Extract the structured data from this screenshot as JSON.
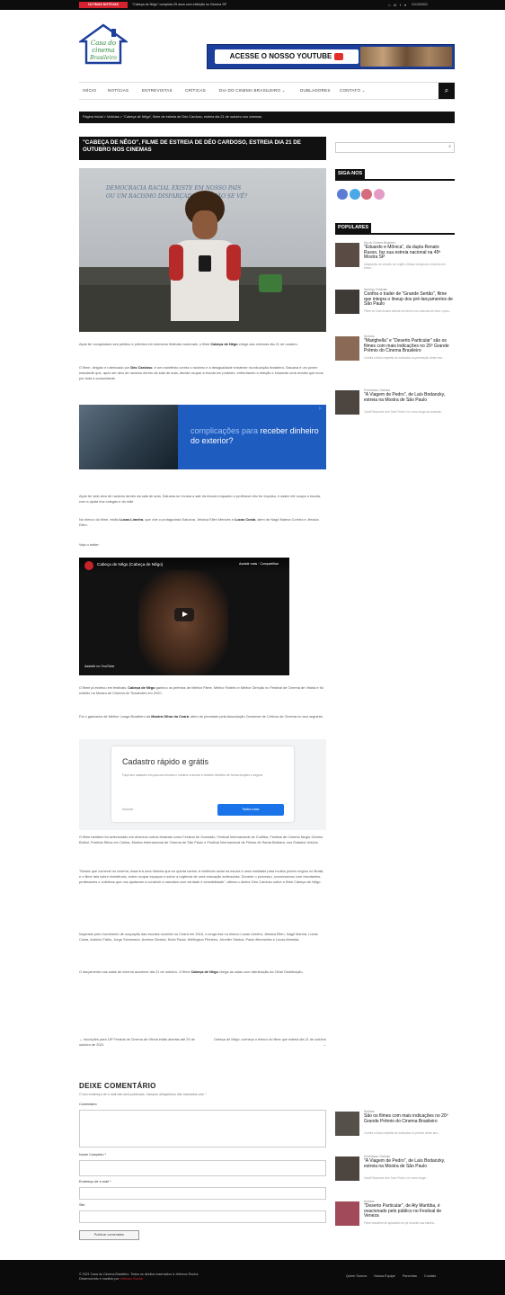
{
  "topbar": {
    "badge": "ÚLTIMAS NOTÍCIAS",
    "ticker": "\"Cabeça de Nêgo\" completa 25 anos com exibição no Cinema SP",
    "social_icons": [
      "home-icon",
      "instagram-icon",
      "facebook-icon",
      "twitter-icon"
    ],
    "date": "21/10/2021"
  },
  "header": {
    "logo_line1": "Casa do",
    "logo_line2": "cinema",
    "logo_line3": "Brasileiro",
    "banner_text": "ACESSE O NOSSO YOUTUBE"
  },
  "nav": {
    "items": [
      "INÍCIO",
      "NOTÍCIAS",
      "ENTREVISTAS",
      "CRÍTICAS",
      "DIA DO CINEMA BRASILEIRO ⌄",
      "DUBLADORES",
      "CONTATO ⌄"
    ]
  },
  "breadcrumb": "Página Inicial  >  Notícias  >  \"Cabeça de Nêgo\", filme de estreia de Déo Cardoso, estreia dia 21 de outubro nos cinemas",
  "article": {
    "title": "\"CABEÇA DE NÊGO\", FILME DE ESTREIA DE DÉO CARDOSO, ESTREIA DIA 21 DE OUTUBRO NOS CINEMAS",
    "board_line1": "DEMOCRACIA RACIAL EXISTE EM NOSSO PAÍS",
    "board_line2": "OU UM RACISMO DISFARÇADO QUE NÃO SE VÊ?",
    "p1_pre": "Após ter conquistado seu público e prêmios em inúmeros festivais nacionais, o filme ",
    "p1_bold": "Cabeça de Nêgo",
    "p1_post": " chega aos cinemas dia 21 de outubro.",
    "p2_pre": "O filme, dirigido e roteirizado por ",
    "p2_bold": "Déo Cardoso",
    "p2_post": ", é um manifesto contra o racismo e a desigualdade existente na educação brasileira. Saluana é um jovem estudante que, após ser alvo de racismo dentro da sala de aula, decide ocupar a escola em protesto, enfrentando a direção e iniciando uma revolta que ecoa por toda a comunidade.",
    "ad1_soft": "complicações para",
    "ad1_strong": "receber dinheiro do exterior?",
    "p3": "Após ter sido alvo de racismo dentro da sala de aula, Saluana se recusa a sair da escola enquanto o professor não for expulso, e assim ele ocupa a escola, com a ajuda dos colegas e da mãe.",
    "p4_pre": "No elenco do filme, estão ",
    "p4_b1": "Lucas Limeira",
    "p4_mid": ", que vive o protagonista Saluana, Jéssica Ellen Mendes e ",
    "p4_b2": "Lucas Costa",
    "p4_post": ", além de Nagô Marina Correia e Jéssica Ellen.",
    "p5": "Veja o trailer:",
    "video_title": "Cabeça de Nêgo (Cabeça de Nêgo)",
    "video_watch": "Assistir mais",
    "video_share": "Compartilhar",
    "video_yt": "Assistir no YouTube",
    "p6_pre": "O filme já estreou em festivais. ",
    "p6_bold": "Cabeça de Nêgo",
    "p6_post": " ganhou os prêmios de Melhor Filme, Melhor Roteiro e Melhor Direção no Festival de Cinema de Vitória e foi exibido na Mostra de Cinema de Tiradentes em 2020.",
    "p7_pre": "Foi o ganhador de Melhor Longa Brasileiro da ",
    "p7_bold": "Mostra Olhar do Ceará",
    "p7_post": ", além de premiado pela Associação Cearense de Críticos de Cinema no ano seguinte.",
    "ad2_head": "Cadastro rápido e grátis",
    "ad2_text": "Faça seu cadastro em poucos minutos e comece a enviar e receber dinheiro de forma simples e segura.",
    "ad2_brand": "Anúncio",
    "ad2_btn": "Saiba mais",
    "p8": "O filme também foi selecionado em diversos outros festivais como Festival de Gramado, Festival Internacional de Curitiba, Festival de Cinema Negro Zózimo Bulbul, Festival África em Cartaz, Mostra Internacional de Cinema de São Paulo e Festival Internacional de Filmes de Santa Barbara, nos Estados Unidos.",
    "p9": "\"Desde que comecei no cinema, essa era uma história que eu queria contar. A violência racial na escola é uma realidade para muitos jovens negros no Brasil, e o filme fala sobre resistência, sobre ocupar espaços e sobre a urgência de uma educação antirracista. Durante o processo, conversamos com estudantes, professores e coletivos que nos ajudaram a construir a narrativa com verdade e sensibilidade\", afirma o diretor Déo Cardoso sobre o filme Cabeça de Nêgo.",
    "p10": "Inspirado pelo movimento de ocupação das escolas ocorrido no Ceará em 2016, o longa traz no elenco Lucas Limeira, Jéssica Ellen, Nagô Marina, Lucas Costa, Antônio Fábio, Jorge Schumann, Andrea Oliveira, Nívia Paula, Wellington Pinheiro, Jennifer Santos, Paulo Benevides e Lucas Almeida.",
    "p11_pre": "O lançamento nas salas de cinema acontece dia 21 de outubro. O filme ",
    "p11_bold": "Cabeça de Nêgo",
    "p11_post": " chega às salas com distribuição da Olhar Distribuição.",
    "prev_post": "← Inscrições para 18º Festival de Cinema de Vitória estão abertas até 29 de outubro de 2021",
    "next_post": "Cabeça de Nêgo: conheça o elenco do filme que estreia dia 21 de outubro →"
  },
  "comments": {
    "heading": "DEIXE COMENTÁRIO",
    "note": "O seu endereço de e-mail não será publicado. Campos obrigatórios são marcados com *",
    "comment_label": "Comentário",
    "name_label": "Nome Completo *",
    "email_label": "Endereço de e-mail *",
    "site_label": "Site",
    "submit": "Publicar comentário"
  },
  "sidebar": {
    "search_placeholder": "",
    "follow_heading": "SIGA-NOS",
    "follow_icons": [
      "facebook-icon",
      "twitter-icon",
      "youtube-icon",
      "instagram-icon"
    ],
    "popular_heading": "POPULARES",
    "popular": [
      {
        "cat": "Dia do Cinema Brasileiro",
        "title": "\"Eduardo e Mônica\", da dupla Renato Russo, faz sua estreia nacional na 45ª Mostra SP",
        "ex": "Adaptação de canção do Legião Urbana chega aos cinemas em breve..."
      },
      {
        "cat": "Notícias, Festivais",
        "title": "Confira o trailer de \"Grande Sertão\", filme que integra o lineup dos pré-lançamentos de São Paulo",
        "ex": "Filme de Guel Arraes estreia em breve nos cinemas de todo o país..."
      },
      {
        "cat": "Notícias",
        "title": "\"Marighella\" e \"Deserto Particular\" são os filmes com mais indicações no 20º Grande Prêmio do Cinema Brasileiro",
        "ex": "Confira a lista completa de indicados na premiação deste ano..."
      },
      {
        "cat": "Entrevistas, Notícias",
        "title": "\"A Viagem de Pedro\", de Laís Bodanzky, estreia na Mostra de São Paulo",
        "ex": "Cauã Reymond vive Dom Pedro I no novo longa da cineasta..."
      }
    ],
    "bottom": [
      {
        "cat": "Notícias",
        "title": "São os filmes com mais indicações no 20º Grande Prêmio do Cinema Brasileiro",
        "ex": "Confira a lista completa de indicados no prêmio deste ano..."
      },
      {
        "cat": "Entrevistas, Notícias",
        "title": "\"A Viagem de Pedro\", de Laís Bodanzky, estreia na Mostra de São Paulo",
        "ex": "Cauã Reymond vive Dom Pedro I no novo longa..."
      },
      {
        "cat": "Notícias",
        "title": "\"Deserto Particular\", de Aly Muritiba, é ovacionado pelo público no Festival de Veneza",
        "ex": "Filme brasileiro foi aplaudido de pé durante sua estreia..."
      }
    ]
  },
  "footer": {
    "copy_line1": "© 2021 Casa do Cinema Brasileiro. Todos os direitos reservados à Jeferson Rocha.",
    "copy_line2_pre": "Desenvolvido e mantido por ",
    "copy_line2_red": "Jeferson Rocha",
    "links": [
      "Quem Somos",
      "Nossa Equipe",
      "Parcerias",
      "Contato"
    ]
  },
  "colors": {
    "accent": "#d6212f",
    "dark": "#111111",
    "brand_blue": "#1b3f9a"
  }
}
